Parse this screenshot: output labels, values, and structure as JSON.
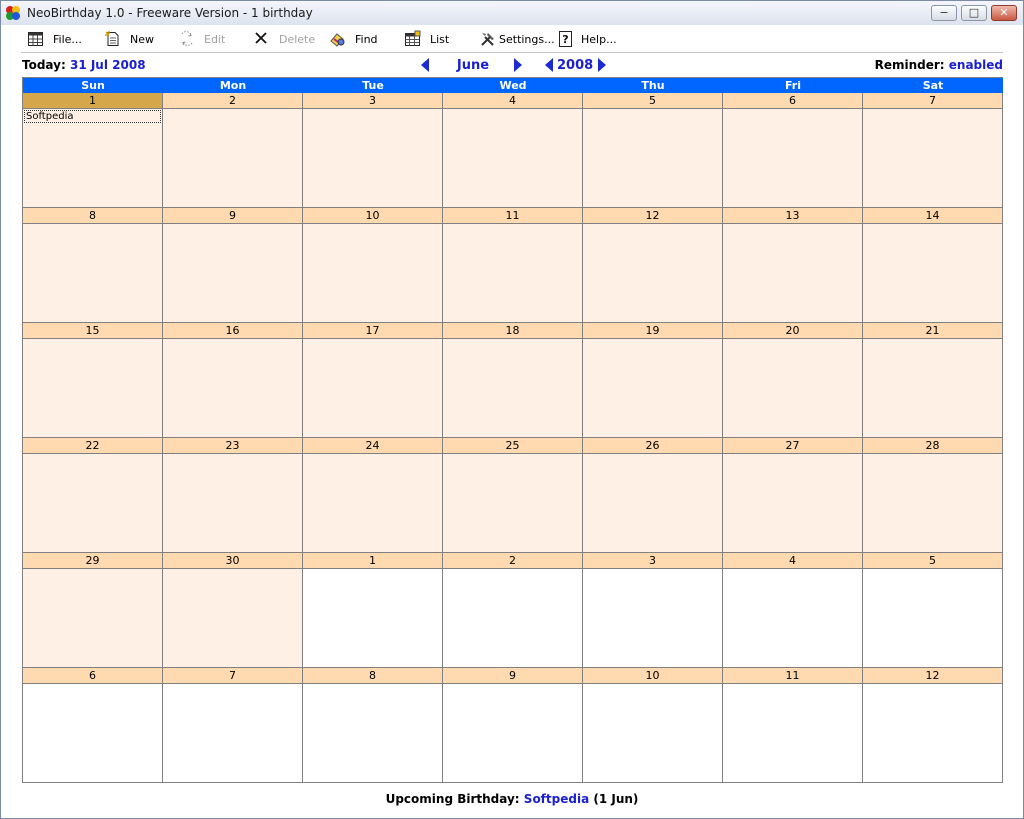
{
  "window": {
    "title": "NeoBirthday 1.0 - Freeware Version - 1 birthday",
    "min_label": "−",
    "max_label": "□",
    "close_label": "✕"
  },
  "toolbar": {
    "items": [
      {
        "label": "File...",
        "icon": "calendar-grid-icon",
        "enabled": true
      },
      {
        "label": "New",
        "icon": "new-document-icon",
        "enabled": true
      },
      {
        "label": "Edit",
        "icon": "edit-arrows-icon",
        "enabled": false
      },
      {
        "label": "Delete",
        "icon": "delete-x-icon",
        "enabled": false
      },
      {
        "label": "Find",
        "icon": "find-icon",
        "enabled": true
      },
      {
        "label": "List",
        "icon": "list-icon",
        "enabled": true
      },
      {
        "label": "Settings...",
        "icon": "tools-icon",
        "enabled": true
      },
      {
        "label": "Help...",
        "icon": "help-icon",
        "enabled": true
      }
    ]
  },
  "infobar": {
    "today_label": "Today:",
    "today_value": "31 Jul 2008",
    "month": "June",
    "year": "2008",
    "reminder_label": "Reminder:",
    "reminder_value": "enabled"
  },
  "calendar": {
    "day_names": [
      "Sun",
      "Mon",
      "Tue",
      "Wed",
      "Thu",
      "Fri",
      "Sat"
    ],
    "weeks": [
      [
        {
          "d": "1",
          "cur": true,
          "selected": true,
          "event": "Softpedia"
        },
        {
          "d": "2",
          "cur": true
        },
        {
          "d": "3",
          "cur": true
        },
        {
          "d": "4",
          "cur": true
        },
        {
          "d": "5",
          "cur": true
        },
        {
          "d": "6",
          "cur": true
        },
        {
          "d": "7",
          "cur": true
        }
      ],
      [
        {
          "d": "8",
          "cur": true
        },
        {
          "d": "9",
          "cur": true
        },
        {
          "d": "10",
          "cur": true
        },
        {
          "d": "11",
          "cur": true
        },
        {
          "d": "12",
          "cur": true
        },
        {
          "d": "13",
          "cur": true
        },
        {
          "d": "14",
          "cur": true
        }
      ],
      [
        {
          "d": "15",
          "cur": true
        },
        {
          "d": "16",
          "cur": true
        },
        {
          "d": "17",
          "cur": true
        },
        {
          "d": "18",
          "cur": true
        },
        {
          "d": "19",
          "cur": true
        },
        {
          "d": "20",
          "cur": true
        },
        {
          "d": "21",
          "cur": true
        }
      ],
      [
        {
          "d": "22",
          "cur": true
        },
        {
          "d": "23",
          "cur": true
        },
        {
          "d": "24",
          "cur": true
        },
        {
          "d": "25",
          "cur": true
        },
        {
          "d": "26",
          "cur": true
        },
        {
          "d": "27",
          "cur": true
        },
        {
          "d": "28",
          "cur": true
        }
      ],
      [
        {
          "d": "29",
          "cur": true
        },
        {
          "d": "30",
          "cur": true
        },
        {
          "d": "1",
          "cur": false
        },
        {
          "d": "2",
          "cur": false
        },
        {
          "d": "3",
          "cur": false
        },
        {
          "d": "4",
          "cur": false
        },
        {
          "d": "5",
          "cur": false
        }
      ],
      [
        {
          "d": "6",
          "cur": false
        },
        {
          "d": "7",
          "cur": false
        },
        {
          "d": "8",
          "cur": false
        },
        {
          "d": "9",
          "cur": false
        },
        {
          "d": "10",
          "cur": false
        },
        {
          "d": "11",
          "cur": false
        },
        {
          "d": "12",
          "cur": false
        }
      ]
    ]
  },
  "footer": {
    "label": "Upcoming Birthday:",
    "name": "Softpedia",
    "date": "(1 Jun)"
  },
  "colors": {
    "header_blue": "#0066ff",
    "day_number_bg": "#ffdab0",
    "current_month_bg": "#fff0e6",
    "selected_day_bg": "#d6a64a",
    "link_blue": "#1a1fd0"
  }
}
